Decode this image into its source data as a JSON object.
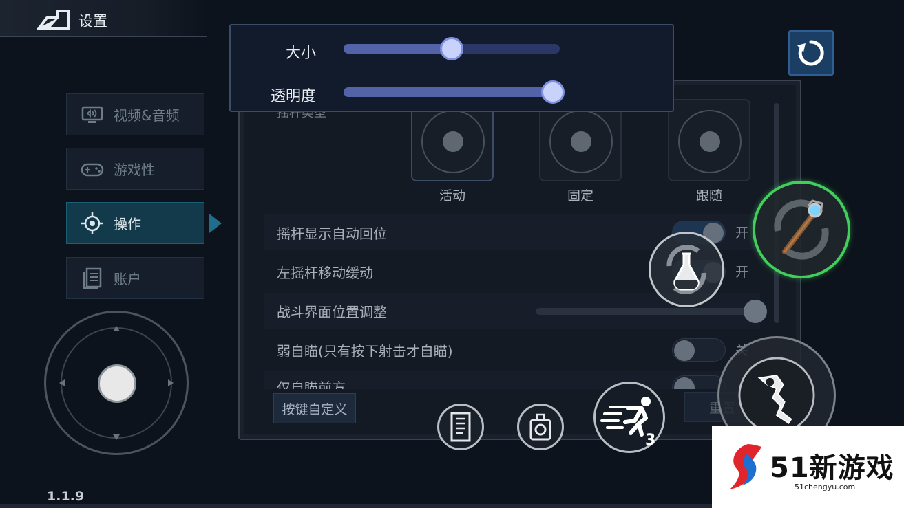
{
  "header": {
    "title": "设置"
  },
  "menu": {
    "items": [
      {
        "label": "视频&音频",
        "icon": "monitor-icon"
      },
      {
        "label": "游戏性",
        "icon": "gamepad-icon"
      },
      {
        "label": "操作",
        "icon": "crosshair-icon",
        "active": true
      },
      {
        "label": "账户",
        "icon": "document-icon"
      }
    ]
  },
  "popup": {
    "size_label": "大小",
    "size_value": 0.5,
    "opacity_label": "透明度",
    "opacity_value": 0.95
  },
  "panel": {
    "joystick_type_label": "摇杆类型",
    "joystick_types": [
      "活动",
      "固定",
      "跟随"
    ],
    "rows": [
      {
        "label": "摇杆显示自动回位",
        "toggle": "on",
        "state_text": "开"
      },
      {
        "label": "左摇杆移动缓动",
        "toggle": "on",
        "state_text": "开"
      },
      {
        "label": "战斗界面位置调整",
        "slider_value": 1.0
      },
      {
        "label": "弱自瞄(只有按下射击才自瞄)",
        "toggle": "off",
        "state_text": "关"
      },
      {
        "label": "仅自瞄前方",
        "toggle": "off",
        "state_text": ""
      }
    ],
    "customize_button": "按键自定义",
    "reset_button": "重置"
  },
  "actions": {
    "dash_count": "3"
  },
  "version": "1.1.9",
  "watermark": {
    "brand": "51新游戏",
    "url": "51chengyu.com"
  },
  "colors": {
    "accent_blue": "#1f6f8c",
    "slider_fill": "#5263a8",
    "skill_ring_green": "#3fcf5a"
  }
}
